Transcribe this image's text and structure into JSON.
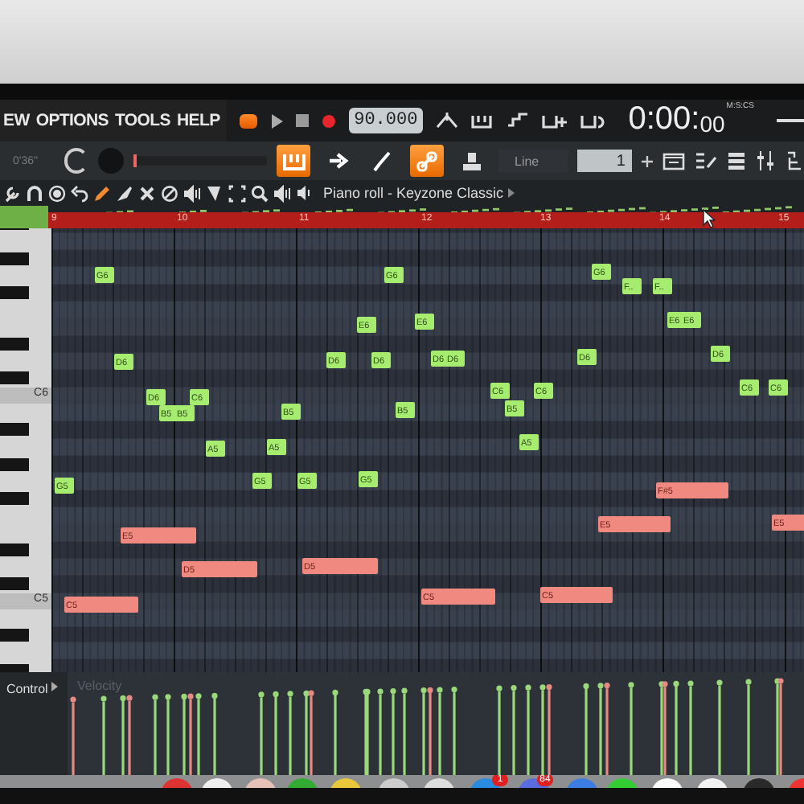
{
  "menu": [
    {
      "label": "EW"
    },
    {
      "label": "OPTIONS"
    },
    {
      "label": "TOOLS"
    },
    {
      "label": "HELP"
    }
  ],
  "transport": {
    "tempo": "90.000",
    "time": "0:00:",
    "time_fraction": "00",
    "time_format": "M:S:CS"
  },
  "toolbar": {
    "elapsed": "0'36\"",
    "snap": "Line",
    "step": "1",
    "position": {
      "level": 0
    }
  },
  "toggles": [
    {
      "kind": "pattern",
      "on": true
    },
    {
      "kind": "arrow",
      "on": false
    },
    {
      "kind": "brush",
      "on": false
    },
    {
      "kind": "link",
      "on": true
    },
    {
      "kind": "stamp",
      "on": false
    }
  ],
  "tools": [
    {
      "kind": "wrench",
      "selected": false
    },
    {
      "kind": "magnet",
      "selected": false
    },
    {
      "kind": "dot",
      "selected": false
    },
    {
      "kind": "undo",
      "selected": false
    },
    {
      "kind": "pencil",
      "selected": true
    },
    {
      "kind": "brush",
      "selected": false
    },
    {
      "kind": "cross",
      "selected": false
    },
    {
      "kind": "ban",
      "selected": false
    },
    {
      "kind": "speaker",
      "selected": false
    },
    {
      "kind": "slice",
      "selected": false
    },
    {
      "kind": "select",
      "selected": false
    },
    {
      "kind": "zoom",
      "selected": false
    },
    {
      "kind": "speaker",
      "selected": false
    }
  ],
  "title": "Piano roll - Keyzone Classic",
  "ruler": [
    "9",
    "10",
    "11",
    "12",
    "13",
    "14",
    "15"
  ],
  "keys": [
    "C6",
    "C5"
  ],
  "notes": [
    {
      "label": "G6",
      "selected": false
    },
    {
      "label": "G6",
      "selected": false
    },
    {
      "label": "G6",
      "selected": false
    },
    {
      "label": "F..",
      "selected": false
    },
    {
      "label": "F..",
      "selected": false
    },
    {
      "label": "E6",
      "selected": false
    },
    {
      "label": "E6",
      "selected": false
    },
    {
      "label": "E6",
      "selected": false
    },
    {
      "label": "E6",
      "selected": false
    },
    {
      "label": "D6",
      "selected": false
    },
    {
      "label": "D6",
      "selected": false
    },
    {
      "label": "D6",
      "selected": false
    },
    {
      "label": "D6",
      "selected": false
    },
    {
      "label": "D6",
      "selected": false
    },
    {
      "label": "D6",
      "selected": false
    },
    {
      "label": "D6",
      "selected": false
    },
    {
      "label": "D6",
      "selected": false
    },
    {
      "label": "C6",
      "selected": false
    },
    {
      "label": "C6",
      "selected": false
    },
    {
      "label": "C6",
      "selected": false
    },
    {
      "label": "C6",
      "selected": false
    },
    {
      "label": "C6",
      "selected": false
    },
    {
      "label": "B5",
      "selected": false
    },
    {
      "label": "B5",
      "selected": false
    },
    {
      "label": "B5",
      "selected": false
    },
    {
      "label": "B5",
      "selected": false
    },
    {
      "label": "B5",
      "selected": false
    },
    {
      "label": "A5",
      "selected": false
    },
    {
      "label": "A5",
      "selected": false
    },
    {
      "label": "A5",
      "selected": false
    },
    {
      "label": "G5",
      "selected": false
    },
    {
      "label": "G5",
      "selected": false
    },
    {
      "label": "G5",
      "selected": false
    },
    {
      "label": "G5",
      "selected": false
    },
    {
      "label": "F#5",
      "selected": true
    },
    {
      "label": "E5",
      "selected": true
    },
    {
      "label": "E5",
      "selected": true
    },
    {
      "label": "E5",
      "selected": true
    },
    {
      "label": "D5",
      "selected": true
    },
    {
      "label": "D5",
      "selected": true
    },
    {
      "label": "C5",
      "selected": true
    },
    {
      "label": "C5",
      "selected": true
    },
    {
      "label": "C5",
      "selected": true
    }
  ],
  "control": {
    "label": "Control",
    "target": "Velocity"
  },
  "dock": [
    {
      "badge": "1"
    },
    {
      "badge": "84"
    }
  ]
}
